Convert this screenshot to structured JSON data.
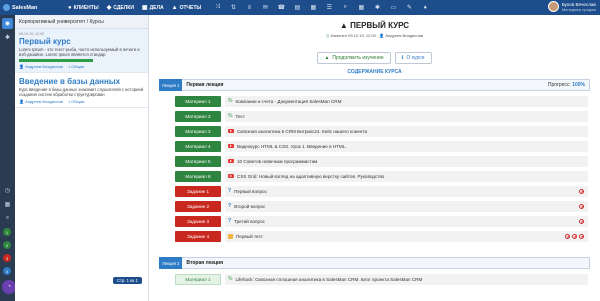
{
  "app": {
    "brand": "SalesMan"
  },
  "nav": [
    {
      "label": "КЛИЕНТЫ",
      "icon": "users-icon",
      "glyph": "👥"
    },
    {
      "label": "СДЕЛКИ",
      "icon": "handshake-icon",
      "glyph": "🤝"
    },
    {
      "label": "ДЕЛА",
      "icon": "briefcase-icon",
      "glyph": "▣"
    },
    {
      "label": "ОТЧЕТЫ",
      "icon": "chart-icon",
      "glyph": "📈"
    }
  ],
  "top_icons": [
    {
      "name": "share-icon",
      "glyph": "⤨"
    },
    {
      "name": "sort-icon",
      "glyph": "⇅"
    },
    {
      "name": "list-icon",
      "glyph": "≡"
    },
    {
      "name": "mail-icon",
      "glyph": "✉"
    },
    {
      "name": "phone-icon",
      "glyph": "☎"
    },
    {
      "name": "message-icon",
      "glyph": "▤"
    },
    {
      "name": "calendar-icon",
      "glyph": "▦"
    },
    {
      "name": "tasks-icon",
      "glyph": "☰"
    },
    {
      "name": "search-icon",
      "glyph": "⌕"
    },
    {
      "name": "grid-icon",
      "glyph": "▦"
    },
    {
      "name": "settings-icon",
      "glyph": "✱"
    },
    {
      "name": "notes-icon",
      "glyph": "▭"
    },
    {
      "name": "pin-icon",
      "glyph": "✎"
    },
    {
      "name": "bell-icon",
      "glyph": "♦"
    }
  ],
  "user": {
    "name": "Бухов Вячеслав",
    "role": "Менеджер продаж"
  },
  "panel": {
    "header": "Корпоративный университет / Курсы",
    "courses": [
      {
        "date": "09.10.19, 12:00",
        "title": "Первый курс",
        "desc": "Lorem Ipsum - это текст-рыба, часто используемый в печати и вэб-дизайне. Lorem Ipsum является стандар",
        "progress": 100,
        "author": "Андреев Владислав",
        "group": "Общая"
      },
      {
        "date": "",
        "title": "Введение в базы данных",
        "desc": "Курс введения в базы данных знакомит слушателей с историей создания систем обработки структурирован",
        "progress": 0,
        "author": "Андреев Владислав",
        "group": "Общая"
      }
    ],
    "footer": "Стр. 1 из 1"
  },
  "main": {
    "title": "ПЕРВЫЙ КУРС",
    "meta_changed": "Изменен 09.10.19, 12:00",
    "meta_author": "Андреев Владислав",
    "continue_label": "Продолжить изучение",
    "about_label": "О курсе",
    "content_head": "СОДЕРЖАНИЕ КУРСА",
    "lectures": [
      {
        "tag": "Лекция 1",
        "name": "Первая лекция",
        "progress_label": "Прогресс:",
        "progress_value": "100%",
        "rows": [
          {
            "badge": "Материал 1",
            "kind": "green",
            "icon": "link",
            "text": "Компании и счета - Документация SalesMan CRM",
            "status": 0
          },
          {
            "badge": "Материал 2",
            "kind": "green",
            "icon": "link",
            "text": "Тест",
            "status": 0
          },
          {
            "badge": "Материал 3",
            "kind": "green",
            "icon": "video",
            "text": "Сквозная аналитика в CRM Битрикс24. Кейс нашего клиента",
            "status": 0
          },
          {
            "badge": "Материал 4",
            "kind": "green",
            "icon": "video",
            "text": "Видеокурс HTML & CSS. Урок 1. Введение в HTML.",
            "status": 0
          },
          {
            "badge": "Материал 5",
            "kind": "green",
            "icon": "video",
            "text": "10 Советов новичкам программистам",
            "status": 0
          },
          {
            "badge": "Материал 6",
            "kind": "green",
            "icon": "video",
            "text": "CSS Grid: Новый взгляд на адаптивную верстку сайтов. Руководство",
            "status": 0
          },
          {
            "badge": "Задание 1",
            "kind": "red",
            "icon": "question",
            "text": "Первый вопрос",
            "status": 1
          },
          {
            "badge": "Задание 2",
            "kind": "red",
            "icon": "question",
            "text": "Второй вопрос",
            "status": 1
          },
          {
            "badge": "Задание 3",
            "kind": "red",
            "icon": "question",
            "text": "Третий вопрос",
            "status": 1
          },
          {
            "badge": "Задание 4",
            "kind": "red",
            "icon": "test",
            "text": "Первый тест",
            "status": 3
          }
        ]
      },
      {
        "tag": "Лекция 2",
        "name": "Вторая лекция",
        "rows": [
          {
            "badge": "Материал 1",
            "kind": "pale",
            "icon": "link",
            "text": "Lifehack: Сквозная сплошная аналитика в SalesMan CRM. Блог проекта SalesMan CRM",
            "status": 0
          }
        ]
      }
    ]
  },
  "rail": {
    "badges": [
      "1",
      "2",
      "3",
      "4",
      "5"
    ]
  }
}
